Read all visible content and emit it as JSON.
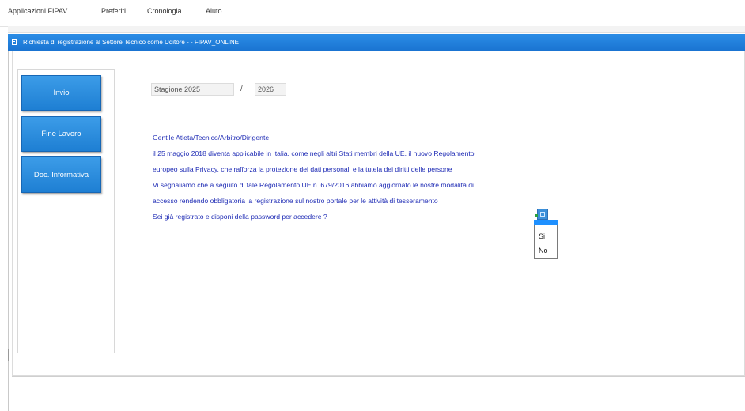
{
  "menubar": {
    "items": [
      {
        "label": "Applicazioni FIPAV"
      },
      {
        "label": "Preferiti"
      },
      {
        "label": "Cronologia"
      },
      {
        "label": "Aiuto"
      }
    ]
  },
  "window": {
    "title": "Richiesta di registrazione al Settore Tecnico come Uditore - - FIPAV_ONLINE"
  },
  "sidebar": {
    "buttons": [
      {
        "label": "Invio"
      },
      {
        "label": "Fine Lavoro"
      },
      {
        "label": "Doc. Informativa"
      }
    ]
  },
  "season": {
    "start": "Stagione 2025",
    "separator": "/",
    "end": "2026"
  },
  "message": {
    "lines": [
      "Gentile Atleta/Tecnico/Arbitro/Dirigente",
      "il 25 maggio 2018 diventa applicabile in Italia, come negli altri Stati membri della UE, il nuovo Regolamento",
      "europeo sulla Privacy, che rafforza la protezione dei dati personali e la tutela dei diritti delle persone",
      "Vi segnaliamo che a seguito di tale Regolamento UE n. 679/2016 abbiamo aggiornato le nostre modalità di",
      "accesso rendendo obbligatoria la registrazione sul nostro portale per le attività di tesseramento",
      "Sei già registrato e disponi della password per accedere ?"
    ]
  },
  "dropdown": {
    "options": [
      "Si",
      "No"
    ]
  },
  "colors": {
    "titlebar": "#1a74d2",
    "button": "#2a8be0",
    "message_text": "#1f2cb5"
  }
}
